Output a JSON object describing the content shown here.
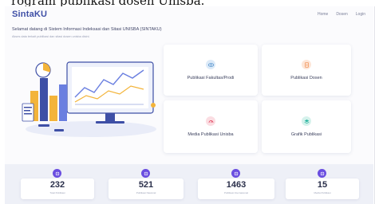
{
  "top_caption": "rogram publikasi dosen Unisba.",
  "brand": {
    "name": "SintaKU",
    "color": "#3e4fa6"
  },
  "nav": {
    "items": [
      "Home",
      "Dosen",
      "Login"
    ]
  },
  "intro": {
    "title": "Selamat datang di Sistem Informasi Indeksasi dan Sitasi UNISBA (SINTAKU)",
    "subtitle": "Akses data terkait publikasi dan sitasi dosen unisba disini."
  },
  "cards": [
    {
      "label": "Publikasi Fakultas/Prodi",
      "icon": "eye-icon",
      "color": "#3b82c4"
    },
    {
      "label": "Publikasi Dosen",
      "icon": "document-icon",
      "color": "#f08a4b"
    },
    {
      "label": "Media Publikasi Unisba",
      "icon": "chart-icon",
      "color": "#e0405a"
    },
    {
      "label": "Grafik Publikasi",
      "icon": "layers-icon",
      "color": "#2bb5a0"
    }
  ],
  "stats": [
    {
      "value": "232",
      "caption": "Total Publikasi"
    },
    {
      "value": "521",
      "caption": "Publikasi Nasional"
    },
    {
      "value": "1463",
      "caption": "Publikasi Internasional"
    },
    {
      "value": "15",
      "caption": "Media Publikasi"
    }
  ],
  "accent": "#6a4ee0"
}
